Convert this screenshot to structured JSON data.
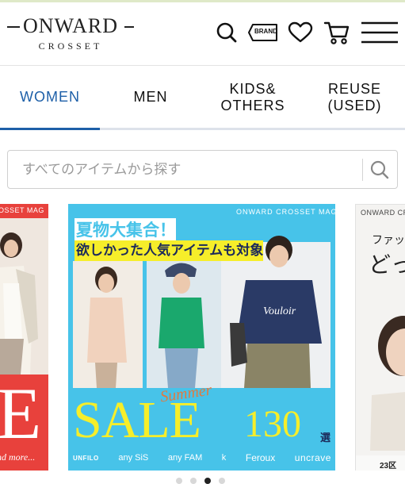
{
  "brand": {
    "logo_text": "ONWARD",
    "logo_sub": "CROSSET"
  },
  "header_icons": {
    "brand_badge": "BRAND",
    "icons": [
      "search-icon",
      "brand-icon",
      "heart-icon",
      "cart-icon",
      "menu-icon"
    ]
  },
  "tabs": [
    {
      "label": "WOMEN",
      "active": true
    },
    {
      "label": "MEN",
      "active": false
    },
    {
      "label": "KIDS&\nOTHERS",
      "active": false
    },
    {
      "label": "REUSE\n(USED)",
      "active": false
    }
  ],
  "search": {
    "placeholder": "すべてのアイテムから探す"
  },
  "banners": {
    "left": {
      "top_text": "OSSET MAG",
      "big_letter": "E",
      "bottom_text": "nd more..."
    },
    "main": {
      "tag": "ONWARD CROSSET MAG",
      "headline_1": "夏物大集合！",
      "headline_2": "欲しかった人気アイテムも対象",
      "script": "Summer",
      "sale": "SALE",
      "count": "130",
      "count_unit": "選",
      "brands": [
        "UNFILO",
        "any SiS",
        "any FAM",
        "k",
        "Feroux",
        "uncrave"
      ],
      "tshirt_print": "Vouloir"
    },
    "right": {
      "tag": "ONWARD CROSSE",
      "line_1": "ファッ",
      "line_2": "どっ",
      "tag_bottom": "23区"
    }
  },
  "carousel": {
    "dots": 4,
    "active_index": 2
  },
  "colors": {
    "accent": "#1d5fa8",
    "banner_main": "#47c3e9",
    "banner_yellow": "#f6ee2a",
    "banner_left": "#e8413c"
  }
}
